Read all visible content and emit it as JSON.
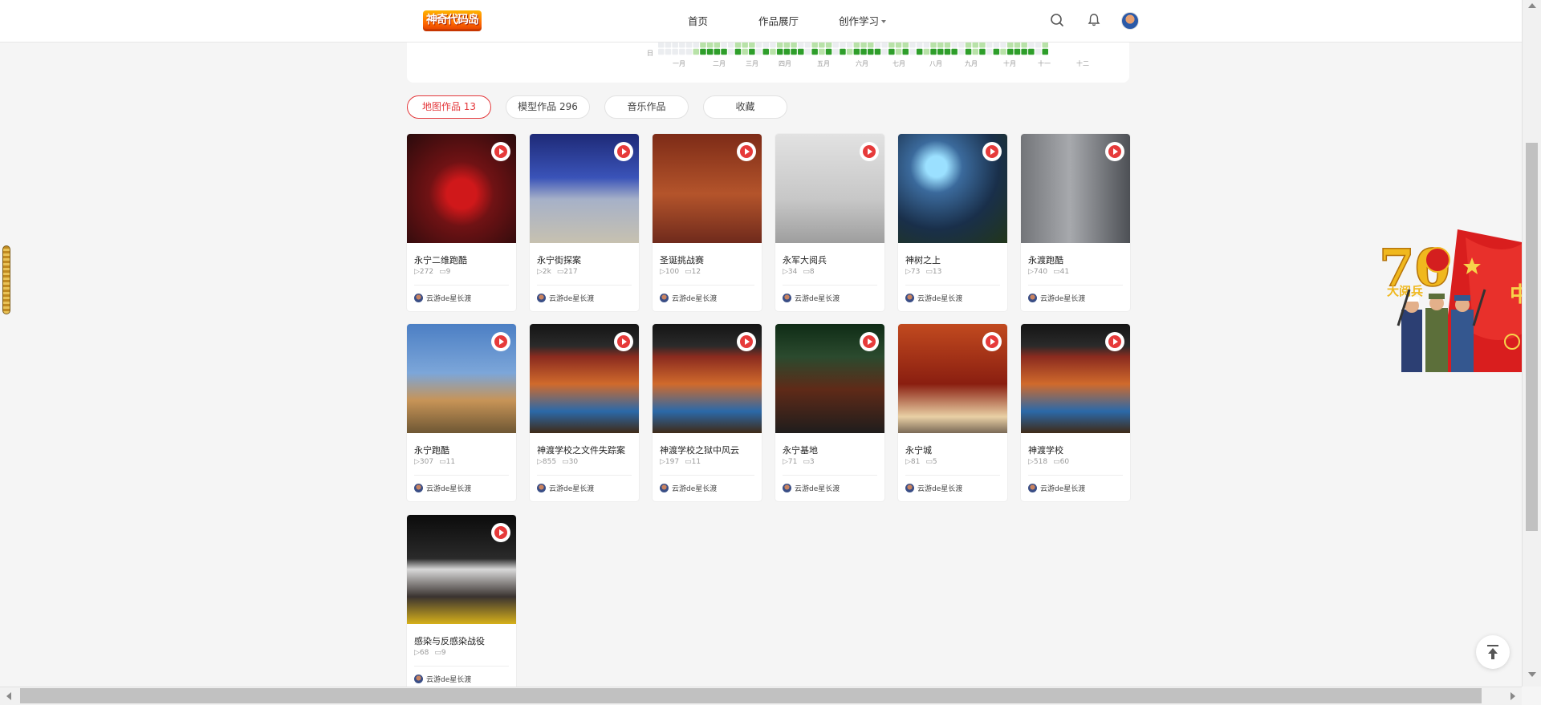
{
  "header": {
    "logo_text": "神奇代码岛",
    "nav": [
      {
        "label": "首页"
      },
      {
        "label": "作品展厅"
      },
      {
        "label": "创作学习"
      }
    ]
  },
  "heatmap": {
    "day_label": "日",
    "months": [
      "一月",
      "二月",
      "三月",
      "四月",
      "五月",
      "六月",
      "七月",
      "八月",
      "九月",
      "十月",
      "十一",
      "十二"
    ]
  },
  "tabs": [
    {
      "label": "地图作品 13",
      "active": true
    },
    {
      "label": "模型作品 296",
      "active": false
    },
    {
      "label": "音乐作品",
      "active": false
    },
    {
      "label": "收藏",
      "active": false
    }
  ],
  "works": [
    {
      "title": "永宁二维跑酷",
      "plays": "272",
      "comments": "9",
      "author": "云游de星长渡"
    },
    {
      "title": "永宁街探案",
      "plays": "2k",
      "comments": "217",
      "author": "云游de星长渡"
    },
    {
      "title": "圣诞挑战赛",
      "plays": "100",
      "comments": "12",
      "author": "云游de星长渡"
    },
    {
      "title": "永军大阅兵",
      "plays": "34",
      "comments": "8",
      "author": "云游de星长渡"
    },
    {
      "title": "神树之上",
      "plays": "73",
      "comments": "13",
      "author": "云游de星长渡"
    },
    {
      "title": "永渡跑酷",
      "plays": "740",
      "comments": "41",
      "author": "云游de星长渡"
    },
    {
      "title": "永宁跑酷",
      "plays": "307",
      "comments": "11",
      "author": "云游de星长渡"
    },
    {
      "title": "神渡学校之文件失踪案",
      "plays": "855",
      "comments": "30",
      "author": "云游de星长渡"
    },
    {
      "title": "神渡学校之狱中风云",
      "plays": "197",
      "comments": "11",
      "author": "云游de星长渡"
    },
    {
      "title": "永宁基地",
      "plays": "71",
      "comments": "3",
      "author": "云游de星长渡"
    },
    {
      "title": "永宁城",
      "plays": "81",
      "comments": "5",
      "author": "云游de星长渡"
    },
    {
      "title": "神渡学校",
      "plays": "518",
      "comments": "60",
      "author": "云游de星长渡"
    },
    {
      "title": "感染与反感染战役",
      "plays": "68",
      "comments": "9",
      "author": "云游de星长渡"
    }
  ],
  "decoration": {
    "badge_text": "70",
    "banner_text": "大阅兵"
  },
  "colors": {
    "accent": "#e4393c",
    "heat_light": "#b8e2a8",
    "heat_dark": "#2e9e2a",
    "heat_empty": "#ebedf0"
  }
}
